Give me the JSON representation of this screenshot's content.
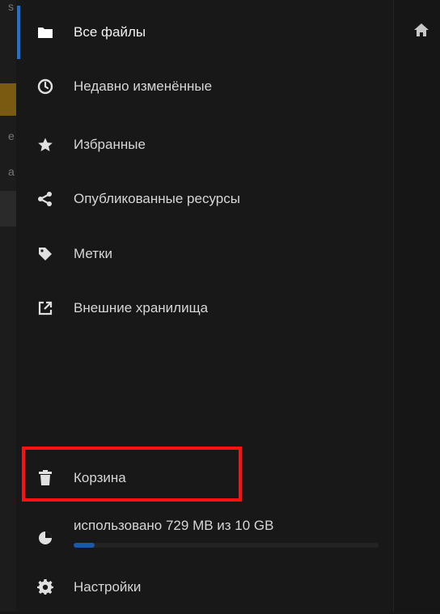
{
  "nav": {
    "items": [
      {
        "label": "Все файлы",
        "icon": "folder-icon",
        "active": true
      },
      {
        "label": "Недавно изменённые",
        "icon": "clock-icon"
      },
      {
        "label": "Избранные",
        "icon": "star-icon"
      },
      {
        "label": "Опубликованные ресурсы",
        "icon": "share-icon"
      },
      {
        "label": "Метки",
        "icon": "tag-icon"
      },
      {
        "label": "Внешние хранилища",
        "icon": "external-storage-icon"
      }
    ],
    "trash": {
      "label": "Корзина",
      "icon": "trash-icon"
    },
    "quota": {
      "label": "использовано 729 MB из 10 GB",
      "used_fraction": 0.07,
      "icon": "pie-chart-icon"
    },
    "settings": {
      "label": "Настройки",
      "icon": "gear-icon"
    }
  },
  "right_pane": {
    "icon": "home-icon"
  },
  "colors": {
    "accent": "#1a74d6",
    "highlight": "#ff1010",
    "quota_fill": "#1e57a8"
  }
}
